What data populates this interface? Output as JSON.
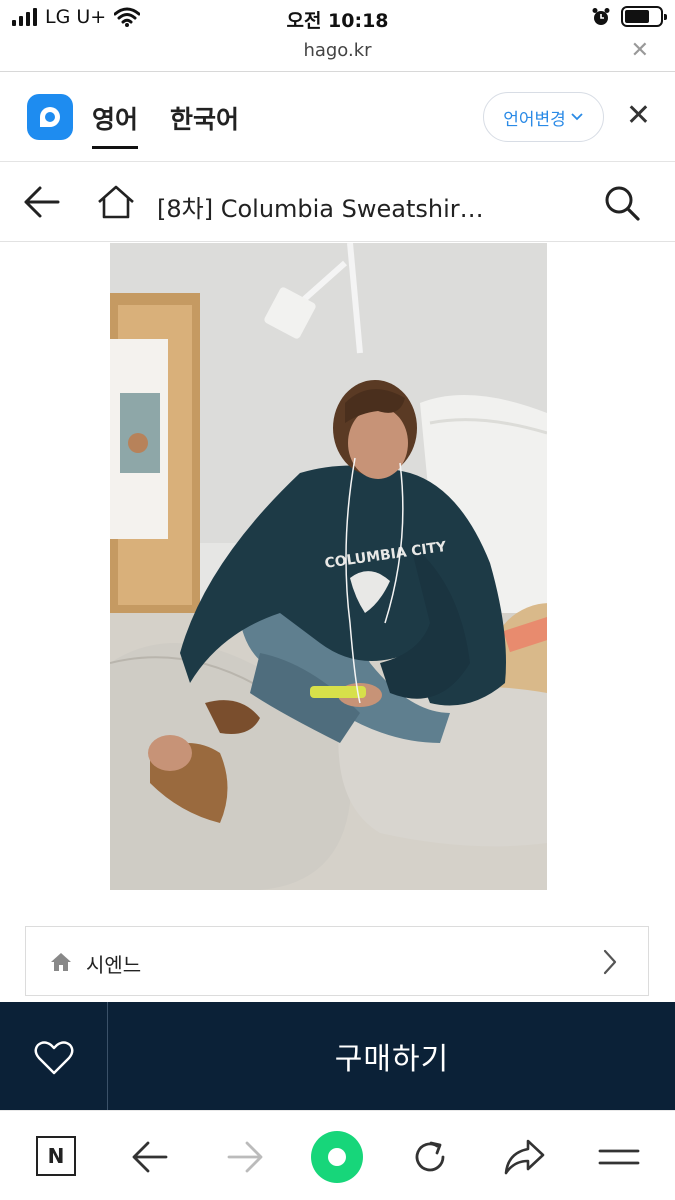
{
  "status_bar": {
    "carrier": "LG U+",
    "time": "오전 10:18"
  },
  "browser": {
    "url": "hago.kr"
  },
  "translate_bar": {
    "languages": [
      "영어",
      "한국어"
    ],
    "active_language": "영어",
    "change_language_label": "언어변경"
  },
  "page_header": {
    "title": "[8차] Columbia Sweatshir…"
  },
  "product": {
    "sweatshirt_text": "COLUMBIA CITY",
    "shop_name": "시엔느"
  },
  "buy_bar": {
    "buy_label": "구매하기"
  },
  "toolbar": {
    "naver_label": "N"
  },
  "colors": {
    "buy_bar_bg": "#0b2137",
    "papago_blue": "#1e8cf0",
    "green_button": "#17d67a",
    "link_blue": "#2a8ae6"
  },
  "icons": [
    "wifi-icon",
    "alarm-icon",
    "battery-icon",
    "papago-icon",
    "back-arrow-icon",
    "home-icon",
    "search-icon",
    "shop-home-icon",
    "chevron-right-icon",
    "heart-icon",
    "forward-arrow-icon",
    "reload-icon",
    "share-icon",
    "menu-icon"
  ]
}
